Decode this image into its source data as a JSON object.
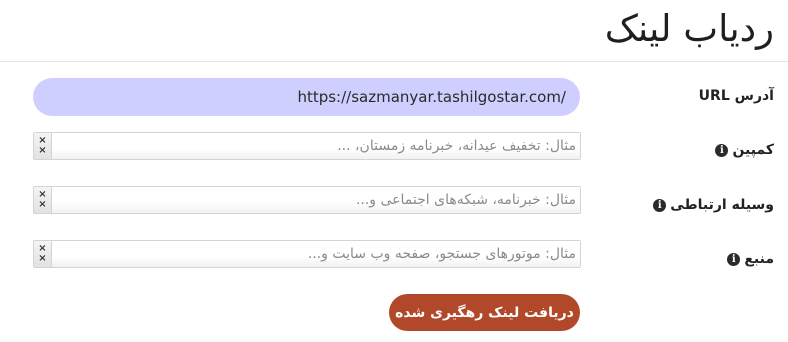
{
  "page": {
    "title": "ردیاب لینک"
  },
  "form": {
    "url_label": "آدرس URL",
    "url_value": "https://sazmanyar.tashilgostar.com/",
    "campaign_label": "کمپین",
    "campaign_placeholder": "مثال: تخفیف عیدانه، خبرنامه زمستان، ...",
    "medium_label": "وسیله ارتباطی",
    "medium_placeholder": "مثال: خبرنامه، شبکه‌های اجتماعی و...",
    "source_label": "منبع",
    "source_placeholder": "مثال: موتورهای جستجو، صفحه وب سایت و...",
    "clear_glyph": "×",
    "info_glyph": "i",
    "submit_label": "دریافت لینک رهگیری شده"
  },
  "colors": {
    "url_field_bg": "#cfcfff",
    "submit_bg": "#b1482a",
    "info_icon_bg": "#2b2b2b"
  },
  "icons": {
    "info": "info-circle-icon",
    "clear": "clear-x-icon"
  }
}
